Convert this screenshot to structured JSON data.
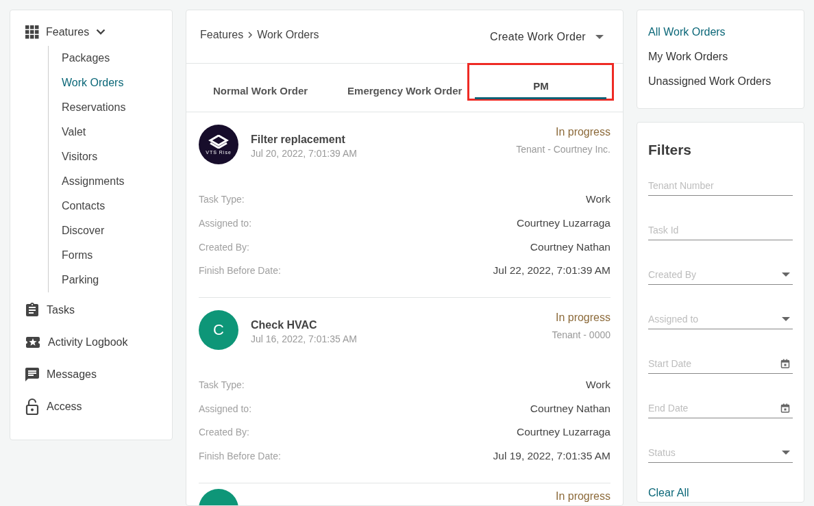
{
  "sidebar": {
    "features": {
      "label": "Features",
      "expanded": true,
      "children": [
        {
          "label": "Packages",
          "selected": false
        },
        {
          "label": "Work Orders",
          "selected": true
        },
        {
          "label": "Reservations",
          "selected": false
        },
        {
          "label": "Valet",
          "selected": false
        },
        {
          "label": "Visitors",
          "selected": false
        },
        {
          "label": "Assignments",
          "selected": false
        },
        {
          "label": "Contacts",
          "selected": false
        },
        {
          "label": "Discover",
          "selected": false
        },
        {
          "label": "Forms",
          "selected": false
        },
        {
          "label": "Parking",
          "selected": false
        }
      ]
    },
    "items": [
      {
        "label": "Tasks",
        "kind": "clipboard"
      },
      {
        "label": "Activity Logbook",
        "kind": "ticket"
      },
      {
        "label": "Messages",
        "kind": "message"
      },
      {
        "label": "Access",
        "kind": "lock"
      }
    ]
  },
  "header": {
    "breadcrumb": {
      "parent": "Features",
      "current": "Work Orders"
    },
    "create_button": "Create Work Order"
  },
  "tabs": [
    {
      "label": "Normal Work Order",
      "selected": false,
      "highlighted": false
    },
    {
      "label": "Emergency Work Order",
      "selected": false,
      "highlighted": false
    },
    {
      "label": "PM",
      "selected": true,
      "highlighted": true
    }
  ],
  "work_orders": [
    {
      "avatar": {
        "kind": "logo",
        "text": "VTS Rise"
      },
      "title": "Filter replacement",
      "date": "Jul 20, 2022, 7:01:39 AM",
      "status": "In progress",
      "tenant": "Tenant - Courtney Inc.",
      "fields": [
        {
          "label": "Task Type:",
          "value": "Work"
        },
        {
          "label": "Assigned to:",
          "value": "Courtney Luzarraga"
        },
        {
          "label": "Created By:",
          "value": "Courtney Nathan"
        },
        {
          "label": "Finish Before Date:",
          "value": "Jul 22, 2022, 7:01:39 AM"
        }
      ]
    },
    {
      "avatar": {
        "kind": "letter",
        "text": "C",
        "color": "#0e9678"
      },
      "title": "Check HVAC",
      "date": "Jul 16, 2022, 7:01:35 AM",
      "status": "In progress",
      "tenant": "Tenant - 0000",
      "fields": [
        {
          "label": "Task Type:",
          "value": "Work"
        },
        {
          "label": "Assigned to:",
          "value": "Courtney Nathan"
        },
        {
          "label": "Created By:",
          "value": "Courtney Luzarraga"
        },
        {
          "label": "Finish Before Date:",
          "value": "Jul 19, 2022, 7:01:35 AM"
        }
      ]
    },
    {
      "avatar": {
        "kind": "letter",
        "color": "#0e9678"
      },
      "status": "In progress"
    }
  ],
  "views": [
    {
      "label": "All Work Orders",
      "selected": true
    },
    {
      "label": "My Work Orders",
      "selected": false
    },
    {
      "label": "Unassigned Work Orders",
      "selected": false
    }
  ],
  "filters": {
    "title": "Filters",
    "fields": [
      {
        "placeholder": "Tenant Number",
        "kind": "text"
      },
      {
        "placeholder": "Task Id",
        "kind": "text"
      },
      {
        "placeholder": "Created By",
        "kind": "select"
      },
      {
        "placeholder": "Assigned to",
        "kind": "select"
      },
      {
        "placeholder": "Start Date",
        "kind": "date"
      },
      {
        "placeholder": "End Date",
        "kind": "date"
      },
      {
        "placeholder": "Status",
        "kind": "select"
      }
    ],
    "clear_button": "Clear All"
  }
}
